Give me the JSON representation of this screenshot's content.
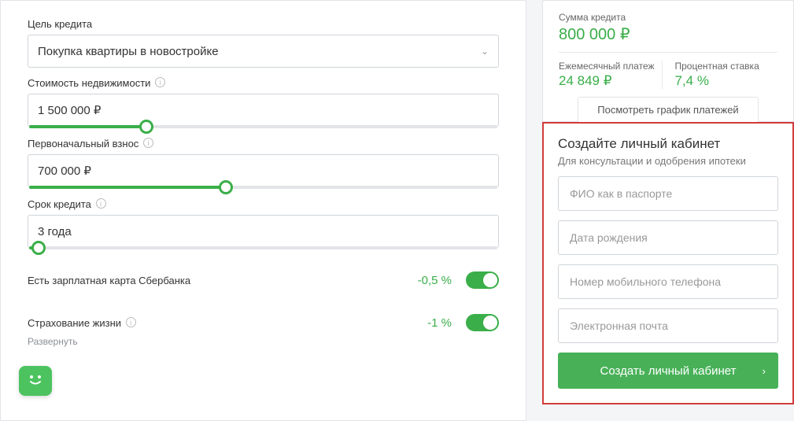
{
  "form": {
    "purpose_label": "Цель кредита",
    "purpose_value": "Покупка квартиры в новостройке",
    "cost_label": "Стоимость недвижимости",
    "cost_value": "1 500 000 ₽",
    "cost_fill": 25,
    "downpay_label": "Первоначальный взнос",
    "downpay_value": "700 000 ₽",
    "downpay_fill": 42,
    "term_label": "Срок кредита",
    "term_value": "3 года",
    "term_fill": 2,
    "salary_label": "Есть зарплатная карта Сбербанка",
    "salary_pct": "-0,5 %",
    "life_label": "Страхование жизни",
    "life_pct": "-1 %",
    "expand": "Развернуть"
  },
  "summary": {
    "amount_label": "Сумма кредита",
    "amount_value": "800 000 ₽",
    "monthly_label": "Ежемесячный платеж",
    "monthly_value": "24 849 ₽",
    "rate_label": "Процентная ставка",
    "rate_value": "7,4 %",
    "schedule_link": "Посмотреть график платежей"
  },
  "cabinet": {
    "title": "Создайте личный кабинет",
    "sub": "Для консультации и одобрения ипотеки",
    "fio_ph": "ФИО как в паспорте",
    "dob_ph": "Дата рождения",
    "phone_ph": "Номер мобильного телефона",
    "email_ph": "Электронная почта",
    "btn": "Создать личный кабинет"
  }
}
